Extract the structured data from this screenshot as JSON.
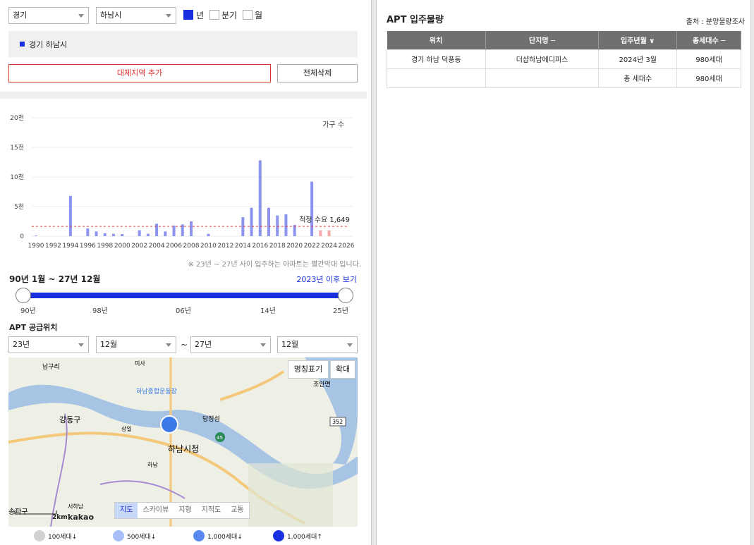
{
  "filters": {
    "province": "경기",
    "city": "하남시",
    "period_options": [
      {
        "label": "년",
        "checked": true
      },
      {
        "label": "분기",
        "checked": false
      },
      {
        "label": "월",
        "checked": false
      }
    ]
  },
  "selected_region": "경기 하남시",
  "buttons": {
    "add_region": "대체지역 추가",
    "delete_all": "전체삭제"
  },
  "chart_data": {
    "type": "bar",
    "unit_label": "가구 수",
    "y_ticks": [
      "0",
      "5천",
      "10천",
      "15천",
      "20천"
    ],
    "ylim": [
      0,
      20000
    ],
    "x_ticks": [
      "1990",
      "1992",
      "1994",
      "1996",
      "1998",
      "2000",
      "2002",
      "2004",
      "2006",
      "2008",
      "2010",
      "2012",
      "2014",
      "2016",
      "2018",
      "2020",
      "2022",
      "2024",
      "2026"
    ],
    "x": [
      1990,
      1991,
      1992,
      1993,
      1994,
      1995,
      1996,
      1997,
      1998,
      1999,
      2000,
      2001,
      2002,
      2003,
      2004,
      2005,
      2006,
      2007,
      2008,
      2009,
      2010,
      2011,
      2012,
      2013,
      2014,
      2015,
      2016,
      2017,
      2018,
      2019,
      2020,
      2021,
      2022,
      2023,
      2024,
      2025,
      2026
    ],
    "values": [
      100,
      0,
      0,
      0,
      6800,
      0,
      1300,
      800,
      500,
      400,
      350,
      0,
      1000,
      400,
      2100,
      800,
      1800,
      2000,
      2500,
      0,
      400,
      0,
      0,
      0,
      3200,
      4800,
      12800,
      4800,
      3500,
      3700,
      1900,
      0,
      9200,
      980,
      980,
      0,
      0
    ],
    "highlight_from": 2023,
    "bar_color": "#8c94f0",
    "highlight_color": "#f4a8a8",
    "reference_line": {
      "label": "적정 수요 1,649",
      "value": 1649,
      "color": "#e04040"
    }
  },
  "chart_note": "※ 23년 ~ 27년 사이 입주하는 아파트는 빨간막대 입니다.",
  "range": {
    "label": "90년 1월 ~ 27년 12월",
    "link": "2023년 이후 보기",
    "ticks": [
      "90년",
      "98년",
      "06년",
      "14년",
      "25년"
    ]
  },
  "supply": {
    "label": "APT 공급위치",
    "from_year": "23년",
    "from_month": "12월",
    "sep": "~",
    "to_year": "27년",
    "to_month": "12월"
  },
  "map": {
    "btn_names": "명칭표기",
    "btn_zoom": "확대",
    "types": [
      "지도",
      "스카이뷰",
      "지형",
      "지적도",
      "교통"
    ],
    "active_type": "지도",
    "scale": "2km",
    "brand": "kakao",
    "places": [
      "하남시청",
      "강동구",
      "하남종합운동장",
      "당정섬",
      "조안면",
      "상일",
      "하남",
      "미사",
      "남구리",
      "서하남",
      "송파구"
    ],
    "road_badges": [
      "352",
      "45"
    ]
  },
  "legend": [
    {
      "label": "100세대↓",
      "color": "#d0d0d0"
    },
    {
      "label": "500세대↓",
      "color": "#a8c0f8"
    },
    {
      "label": "1,000세대↓",
      "color": "#5a8af0"
    },
    {
      "label": "1,000세대↑",
      "color": "#1a2fe0"
    }
  ],
  "right": {
    "title": "APT 입주물량",
    "source": "출처 : 분양물량조사",
    "headers": [
      "위치",
      "단지명 ─",
      "입주년월 ∨",
      "총세대수 ─"
    ],
    "rows": [
      [
        "경기 하남 덕풍동",
        "더샵하남에디피스",
        "2024년 3월",
        "980세대"
      ]
    ],
    "total_label": "총 세대수",
    "total_value": "980세대"
  }
}
